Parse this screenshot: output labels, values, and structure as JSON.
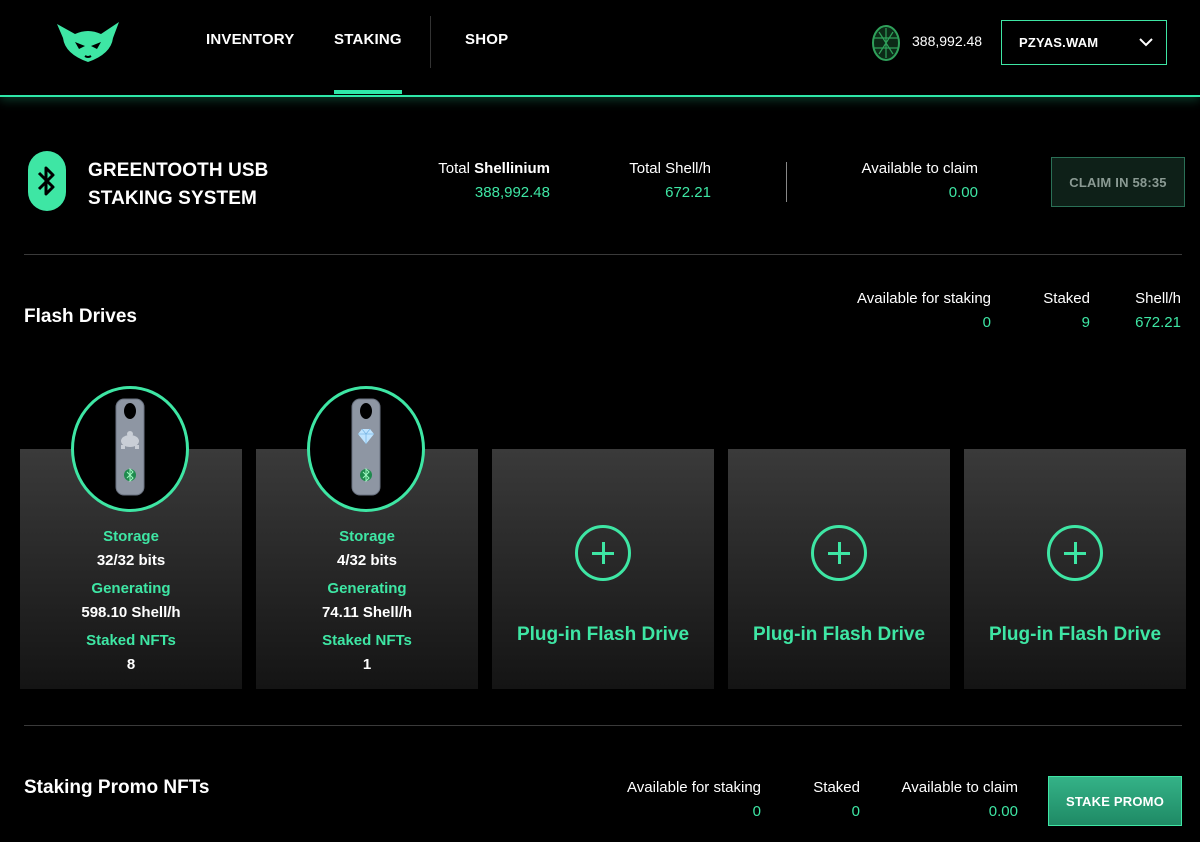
{
  "nav": {
    "links": [
      "INVENTORY",
      "STAKING",
      "SHOP"
    ],
    "balance": "388,992.48",
    "account": "PZYAS.WAM"
  },
  "system": {
    "title_line1": "GREENTOOTH USB",
    "title_line2": "STAKING SYSTEM",
    "total_prefix": "Total",
    "total_shellinium_label": "Shellinium",
    "total_shellinium_value": "388,992.48",
    "total_shell_label": "Total Shell/h",
    "total_shell_value": "672.21",
    "available_claim_label": "Available to claim",
    "available_claim_value": "0.00",
    "claim_button": "CLAIM IN 58:35"
  },
  "flash": {
    "title": "Flash Drives",
    "available_label": "Available for staking",
    "available_value": "0",
    "staked_label": "Staked",
    "staked_value": "9",
    "shell_label": "Shell/h",
    "shell_value": "672.21",
    "labels": {
      "storage": "Storage",
      "generating": "Generating",
      "staked_nfts": "Staked NFTs"
    },
    "drives": [
      {
        "storage": "32/32 bits",
        "generating": "598.10 Shell/h",
        "staked_nfts": "8",
        "emblem": "turtle-icon"
      },
      {
        "storage": "4/32 bits",
        "generating": "74.11 Shell/h",
        "staked_nfts": "1",
        "emblem": "diamond-icon"
      }
    ],
    "plug_label": "Plug-in Flash Drive"
  },
  "promo": {
    "title": "Staking Promo NFTs",
    "available_label": "Available for staking",
    "available_value": "0",
    "staked_label": "Staked",
    "staked_value": "0",
    "claim_label": "Available to claim",
    "claim_value": "0.00",
    "button": "STAKE PROMO"
  },
  "colors": {
    "accent": "#3ee6a4",
    "background": "#000000",
    "card": "#2a2a2a"
  }
}
